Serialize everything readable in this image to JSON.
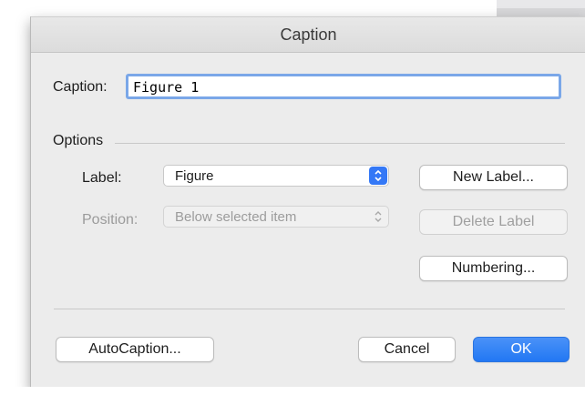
{
  "dialog": {
    "title": "Caption",
    "caption_label": "Caption:",
    "caption_value": "Figure 1",
    "options_label": "Options",
    "label_label": "Label:",
    "label_value": "Figure",
    "position_label": "Position:",
    "position_value": "Below selected item",
    "new_label_button": "New Label...",
    "delete_label_button": "Delete Label",
    "numbering_button": "Numbering...",
    "autocaption_button": "AutoCaption...",
    "cancel_button": "Cancel",
    "ok_button": "OK"
  },
  "colors": {
    "accent": "#3478f6",
    "dialog_bg": "#ececec",
    "focus_ring": "#7aa7e8"
  }
}
